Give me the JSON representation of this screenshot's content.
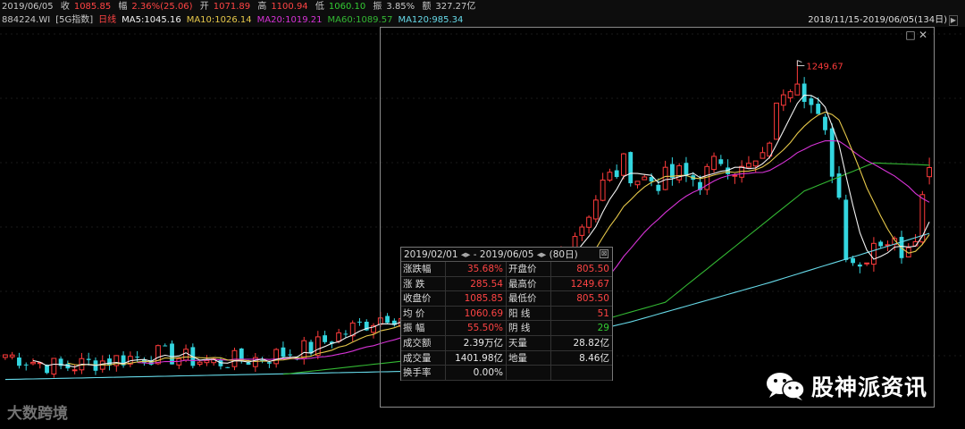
{
  "quote_bar": {
    "date": "2019/06/05",
    "close_label": "收",
    "close": "1085.85",
    "change_label": "幅",
    "change": "2.36%(25.06)",
    "open_label": "开",
    "open": "1071.89",
    "high_label": "高",
    "high": "1100.94",
    "low_label": "低",
    "low": "1060.10",
    "amplitude_label": "振",
    "amplitude": "3.85%",
    "amount_label": "额",
    "amount": "327.27亿"
  },
  "title_bar": {
    "code": "884224.WI",
    "index_name": "[5G指数]",
    "period": "日线",
    "ma5": "MA5:1045.16",
    "ma10": "MA10:1026.14",
    "ma20": "MA20:1019.21",
    "ma60": "MA60:1089.57",
    "ma120": "MA120:985.34",
    "date_range": "2018/11/15-2019/06/05(134日)",
    "scroll_arrow": "▶"
  },
  "selection_tools": {
    "restore": "□",
    "close": "✕"
  },
  "stat_panel": {
    "start": "2019/02/01",
    "separator": "- 2019/06/05",
    "days": "(80日)",
    "close_glyph": "⊠",
    "rows": [
      {
        "k1": "涨跌幅",
        "v1": "35.68%",
        "k2": "开盘价",
        "v2": "805.50"
      },
      {
        "k1": "涨  跌",
        "v1": "285.54",
        "k2": "最高价",
        "v2": "1249.67"
      },
      {
        "k1": "收盘价",
        "v1": "1085.85",
        "k2": "最低价",
        "v2": "805.50"
      },
      {
        "k1": "均  价",
        "v1": "1060.69",
        "k2": "阳  线",
        "v2": "51"
      },
      {
        "k1": "振  幅",
        "v1": "55.50%",
        "k2": "阴  线",
        "v2": "29"
      },
      {
        "k1": "成交额",
        "v1": "2.39万亿",
        "k2": "天量",
        "v2": "28.82亿"
      },
      {
        "k1": "成交量",
        "v1": "1401.98亿",
        "k2": "地量",
        "v2": "8.46亿"
      },
      {
        "k1": "换手率",
        "v1": "0.00%",
        "k2": "",
        "v2": ""
      }
    ]
  },
  "watermarks": {
    "left": "大数跨境",
    "right": "股神派资讯"
  },
  "colors": {
    "up": "#ff3b3b",
    "down": "#33d6e0",
    "ma5": "#f2f2f2",
    "ma10": "#e6c84a",
    "ma20": "#d633d6",
    "ma60": "#33b833",
    "ma120": "#66d9e8"
  },
  "chart_data": {
    "type": "candlestick",
    "title": "884224.WI [5G指数] 日线",
    "date_range": [
      "2018/11/15",
      "2019/06/05"
    ],
    "days": 134,
    "ylim": [
      700,
      1290
    ],
    "max_annotation": {
      "value": 1249.67,
      "label": "1249.67"
    },
    "last_candle": {
      "date": "2019/06/05",
      "open": 1071.89,
      "high": 1100.94,
      "low": 1060.1,
      "close": 1085.85
    },
    "series": [
      {
        "name": "MA5",
        "last": 1045.16
      },
      {
        "name": "MA10",
        "last": 1026.14
      },
      {
        "name": "MA20",
        "last": 1019.21
      },
      {
        "name": "MA60",
        "last": 1089.57
      },
      {
        "name": "MA120",
        "last": 985.34
      }
    ],
    "keypoints": [
      {
        "i": 0,
        "c": 800
      },
      {
        "i": 8,
        "c": 780
      },
      {
        "i": 15,
        "c": 792
      },
      {
        "i": 22,
        "c": 800
      },
      {
        "i": 30,
        "c": 788
      },
      {
        "i": 37,
        "c": 795
      },
      {
        "i": 44,
        "c": 810
      },
      {
        "i": 50,
        "c": 840
      },
      {
        "i": 55,
        "c": 862
      },
      {
        "i": 60,
        "c": 852
      },
      {
        "i": 65,
        "c": 845
      },
      {
        "i": 69,
        "c": 810
      },
      {
        "i": 72,
        "c": 830
      },
      {
        "i": 76,
        "c": 880
      },
      {
        "i": 80,
        "c": 960
      },
      {
        "i": 83,
        "c": 1000
      },
      {
        "i": 86,
        "c": 1060
      },
      {
        "i": 89,
        "c": 1090
      },
      {
        "i": 91,
        "c": 1070
      },
      {
        "i": 94,
        "c": 1065
      },
      {
        "i": 97,
        "c": 1075
      },
      {
        "i": 100,
        "c": 1065
      },
      {
        "i": 103,
        "c": 1100
      },
      {
        "i": 106,
        "c": 1080
      },
      {
        "i": 109,
        "c": 1095
      },
      {
        "i": 112,
        "c": 1210
      },
      {
        "i": 114,
        "c": 1230
      },
      {
        "i": 116,
        "c": 1180
      },
      {
        "i": 118,
        "c": 1130
      },
      {
        "i": 120,
        "c": 1040
      },
      {
        "i": 121,
        "c": 960
      },
      {
        "i": 123,
        "c": 935
      },
      {
        "i": 125,
        "c": 975
      },
      {
        "i": 127,
        "c": 975
      },
      {
        "i": 129,
        "c": 960
      },
      {
        "i": 131,
        "c": 990
      },
      {
        "i": 132,
        "c": 1040
      },
      {
        "i": 133,
        "c": 1085.85
      }
    ],
    "ma_keypoints": {
      "MA60": [
        {
          "i": 40,
          "c": 770
        },
        {
          "i": 70,
          "c": 805
        },
        {
          "i": 95,
          "c": 880
        },
        {
          "i": 115,
          "c": 1050
        },
        {
          "i": 125,
          "c": 1093
        },
        {
          "i": 133,
          "c": 1089.57
        }
      ],
      "MA120": [
        {
          "i": 0,
          "c": 762
        },
        {
          "i": 60,
          "c": 775
        },
        {
          "i": 90,
          "c": 850
        },
        {
          "i": 110,
          "c": 910
        },
        {
          "i": 133,
          "c": 985.34
        }
      ]
    }
  }
}
